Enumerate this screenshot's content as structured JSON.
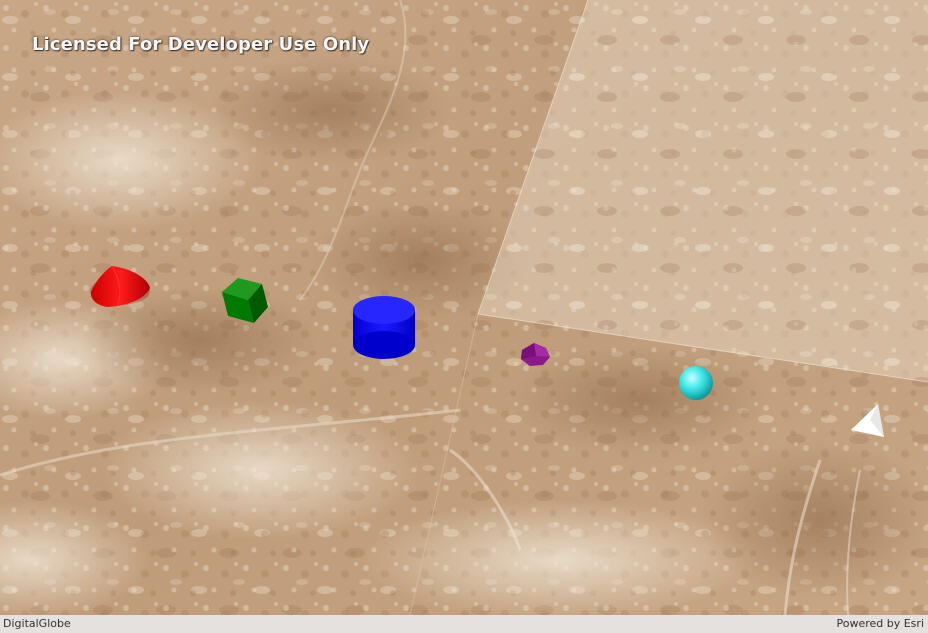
{
  "map": {
    "license_watermark": "Licensed For Developer Use Only",
    "basemap_attribution": "DigitalGlobe",
    "esri_attribution": "Powered by Esri"
  },
  "graphics": [
    {
      "shape": "cone",
      "color": "#ff0000"
    },
    {
      "shape": "cube",
      "color": "#008000"
    },
    {
      "shape": "cylinder",
      "color": "#0000ff"
    },
    {
      "shape": "diamond",
      "color": "#800080"
    },
    {
      "shape": "sphere",
      "color": "#00ffff"
    },
    {
      "shape": "tetrahedron",
      "color": "#ffffff"
    }
  ]
}
